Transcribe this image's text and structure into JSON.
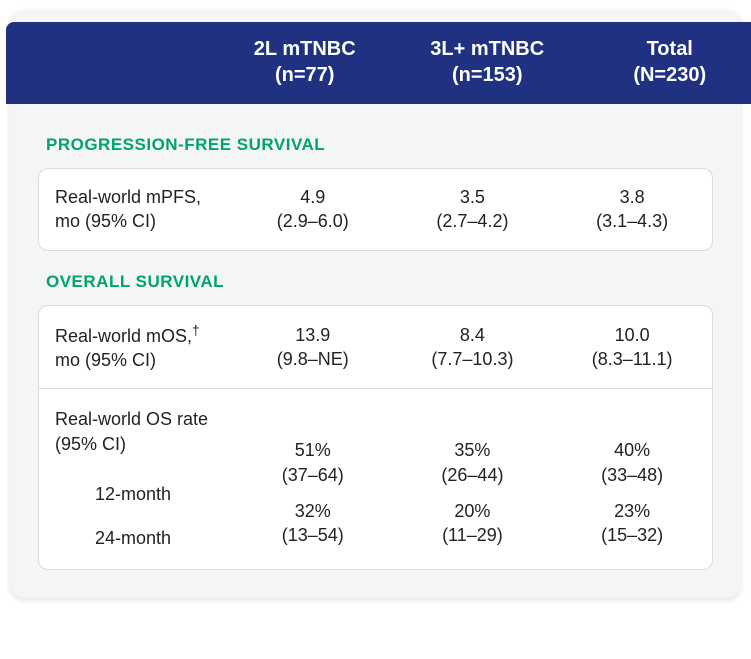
{
  "header": {
    "col1_line1": "2L mTNBC",
    "col1_line2": "(n=77)",
    "col2_line1": "3L+ mTNBC",
    "col2_line2": "(n=153)",
    "col3_line1": "Total",
    "col3_line2": "(N=230)"
  },
  "sections": {
    "pfs": {
      "title": "PROGRESSION-FREE SURVIVAL",
      "row1": {
        "label_line1": "Real-world mPFS,",
        "label_line2": "mo (95% CI)",
        "c1_val": "4.9",
        "c1_ci": "(2.9–6.0)",
        "c2_val": "3.5",
        "c2_ci": "(2.7–4.2)",
        "c3_val": "3.8",
        "c3_ci": "(3.1–4.3)"
      }
    },
    "os": {
      "title": "OVERALL SURVIVAL",
      "row1": {
        "label_line1a": "Real-world mOS,",
        "label_dagger": "†",
        "label_line2": "mo (95% CI)",
        "c1_val": "13.9",
        "c1_ci": "(9.8–NE)",
        "c2_val": "8.4",
        "c2_ci": "(7.7–10.3)",
        "c3_val": "10.0",
        "c3_ci": "(8.3–11.1)"
      },
      "row2": {
        "label_line1": "Real-world OS rate",
        "label_line2": "(95% CI)",
        "sub_a": "12-month",
        "sub_b": "24-month",
        "c1_a_val": "51%",
        "c1_a_ci": "(37–64)",
        "c1_b_val": "32%",
        "c1_b_ci": "(13–54)",
        "c2_a_val": "35%",
        "c2_a_ci": "(26–44)",
        "c2_b_val": "20%",
        "c2_b_ci": "(11–29)",
        "c3_a_val": "40%",
        "c3_a_ci": "(33–48)",
        "c3_b_val": "23%",
        "c3_b_ci": "(15–32)"
      }
    }
  }
}
